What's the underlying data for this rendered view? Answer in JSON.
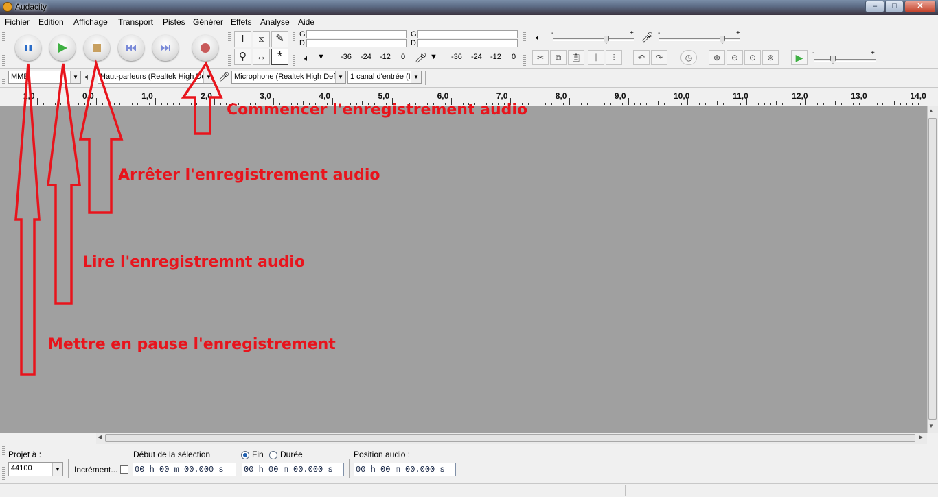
{
  "window": {
    "title": "Audacity",
    "controls": {
      "minimize": "–",
      "maximize": "□",
      "close": "✕"
    }
  },
  "menu": [
    "Fichier",
    "Edition",
    "Affichage",
    "Transport",
    "Pistes",
    "Générer",
    "Effets",
    "Analyse",
    "Aide"
  ],
  "transport": {
    "buttons": [
      {
        "name": "pause",
        "icon": "pause-icon"
      },
      {
        "name": "play",
        "icon": "play-icon"
      },
      {
        "name": "stop",
        "icon": "stop-icon"
      },
      {
        "name": "skip-start",
        "icon": "skip-start-icon"
      },
      {
        "name": "skip-end",
        "icon": "skip-end-icon"
      },
      {
        "name": "record",
        "icon": "record-icon"
      }
    ]
  },
  "meters": {
    "playback": {
      "left_label": "G",
      "right_label": "D",
      "scale": [
        "-36",
        "-24",
        "-12",
        "0"
      ]
    },
    "record": {
      "left_label": "G",
      "right_label": "D",
      "scale": [
        "-36",
        "-24",
        "-12",
        "0"
      ]
    }
  },
  "mixer": {
    "output_plus": "+",
    "output_minus": "-",
    "input_plus": "+",
    "input_minus": "-",
    "speed_plus": "+",
    "speed_minus": "-"
  },
  "devices": {
    "host": "MME",
    "output": "Haut-parleurs (Realtek High De",
    "input": "Microphone (Realtek High Defi",
    "channels": "1 canal d'entrée (I"
  },
  "ruler": {
    "labels": [
      "1,0",
      "0,0",
      "1,0",
      "2,0",
      "3,0",
      "4,0",
      "5,0",
      "6,0",
      "7,0",
      "8,0",
      "9,0",
      "10,0",
      "11,0",
      "12,0",
      "13,0",
      "14,0"
    ]
  },
  "selection": {
    "project_rate_label": "Projet à :",
    "project_rate_value": "44100",
    "snap_label": "Incrément...",
    "start_label": "Début de la sélection",
    "end_label": "Fin",
    "length_label": "Durée",
    "start_value": "00 h 00 m 00.000 s",
    "end_value": "00 h 00 m 00.000 s",
    "position_label": "Position audio :",
    "position_value": "00 h 00 m 00.000 s"
  },
  "annotations": {
    "record": "Commencer l'enregistrement audio",
    "stop": "Arrêter l'enregistrement audio",
    "play": "Lire l'enregistremnt audio",
    "pause": "Mettre en pause l'enregistrement",
    "color": "#e8141c"
  }
}
